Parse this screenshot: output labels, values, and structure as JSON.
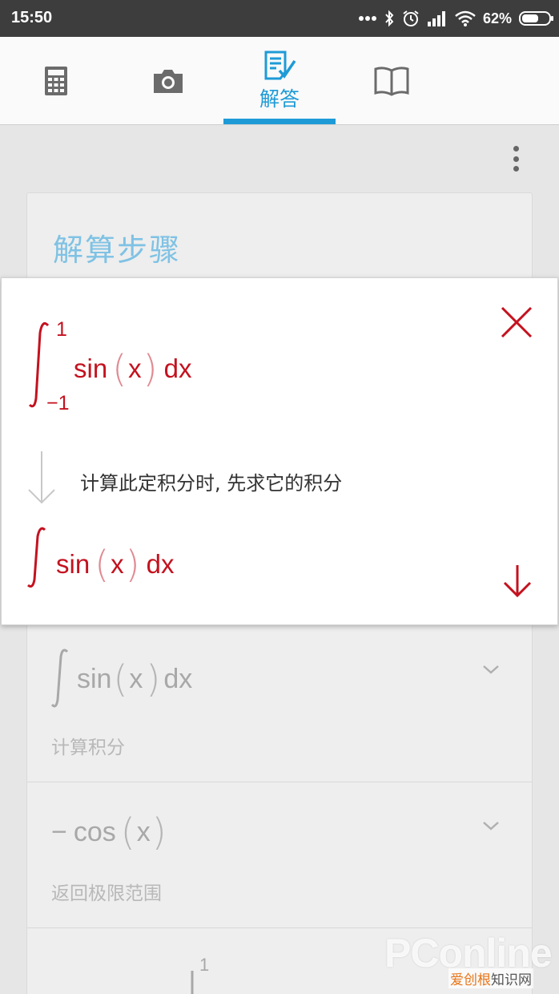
{
  "status_bar": {
    "time": "15:50",
    "battery_percent": "62%",
    "battery_level": 0.62,
    "icons": [
      "more-dots-icon",
      "bluetooth-icon",
      "alarm-icon",
      "signal-icon",
      "wifi-icon",
      "battery-icon"
    ]
  },
  "toolbar": {
    "tabs": [
      {
        "icon": "calculator-icon",
        "label": ""
      },
      {
        "icon": "camera-icon",
        "label": ""
      },
      {
        "icon": "solution-icon",
        "label": "解答",
        "active": true
      },
      {
        "icon": "book-icon",
        "label": ""
      }
    ],
    "accent_color": "#1e9bd7"
  },
  "card": {
    "title": "解算步骤",
    "steps": [
      {
        "math": {
          "func": "sin",
          "var": "x",
          "d": "dx"
        },
        "description": "计算积分"
      },
      {
        "math": {
          "prefix": "−",
          "func": "cos",
          "var": "x"
        },
        "description": "返回极限范围"
      },
      {
        "math": {
          "upper": "1"
        }
      }
    ]
  },
  "popup": {
    "integral": {
      "lower": "−1",
      "upper": "1",
      "func": "sin",
      "var": "x",
      "d": "dx"
    },
    "step_text": "计算此定积分时, 先求它的积分",
    "result": {
      "func": "sin",
      "var": "x",
      "d": "dx"
    },
    "color": "#c4121f"
  },
  "watermark": {
    "brand": "PConline",
    "site_prefix": "爱创根",
    "site_suffix": "知识网"
  }
}
